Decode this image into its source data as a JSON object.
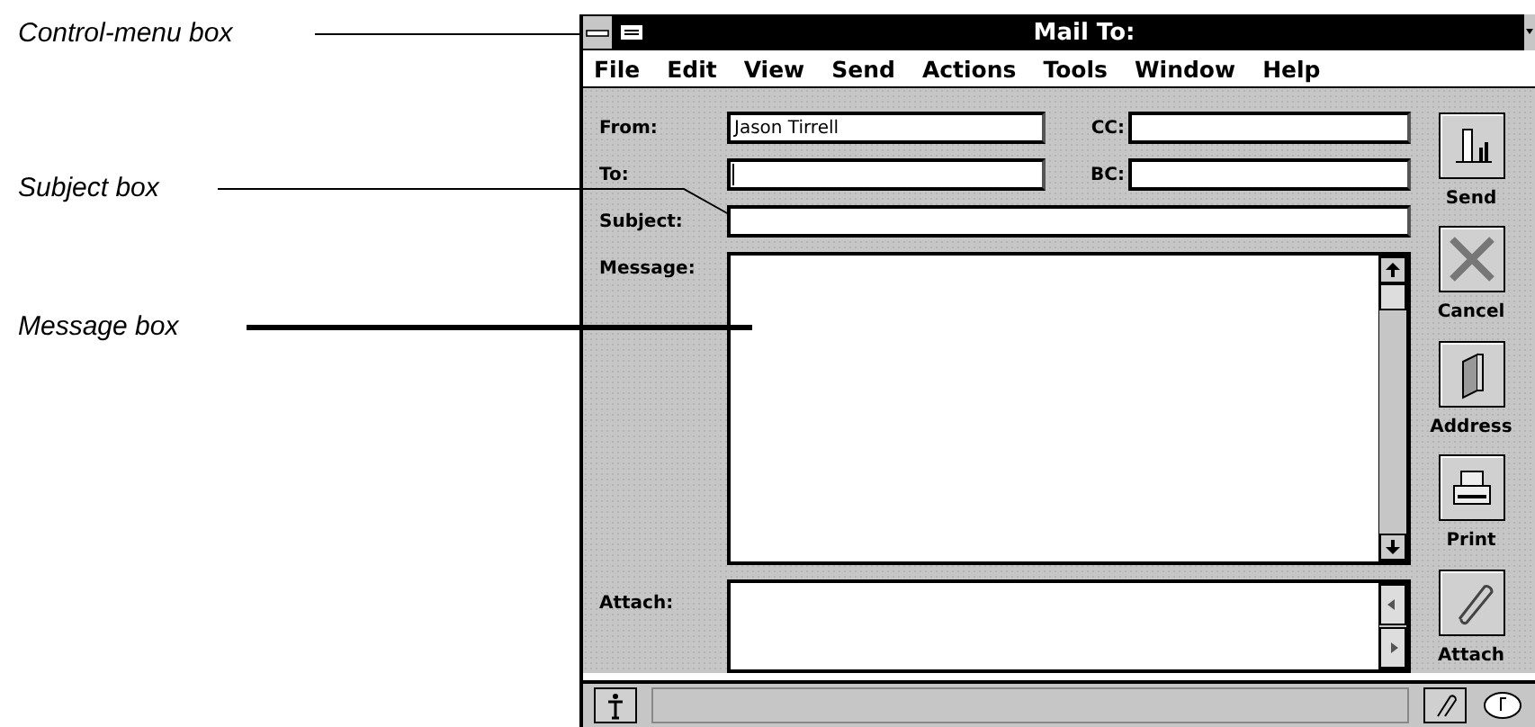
{
  "callouts": [
    {
      "text": "Control-menu box",
      "kind": "thin"
    },
    {
      "text": "Subject box",
      "kind": "bent"
    },
    {
      "text": "Message box",
      "kind": "thick"
    }
  ],
  "window": {
    "title": "Mail To:",
    "menu": [
      "File",
      "Edit",
      "View",
      "Send",
      "Actions",
      "Tools",
      "Window",
      "Help"
    ],
    "from": {
      "label": "From:",
      "value": "Jason Tirrell"
    },
    "cc": {
      "label": "CC:"
    },
    "to": {
      "label": "To:",
      "focused": true
    },
    "bc": {
      "label": "BC:"
    },
    "subject": {
      "label": "Subject:"
    },
    "message": {
      "label": "Message:"
    },
    "attach": {
      "label": "Attach:"
    },
    "toolbar": [
      {
        "label": "Send",
        "kind": "send"
      },
      {
        "label": "Cancel",
        "kind": "cancel"
      },
      {
        "label": "Address",
        "kind": "address"
      },
      {
        "label": "Print",
        "kind": "print"
      },
      {
        "label": "Attach",
        "kind": "attach"
      }
    ]
  }
}
